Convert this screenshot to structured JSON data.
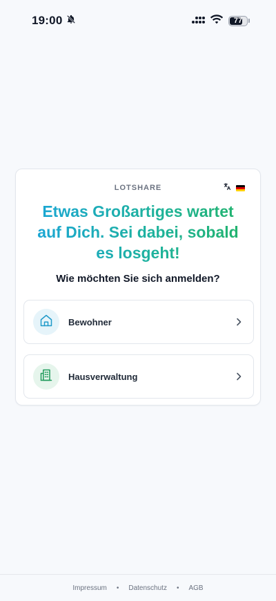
{
  "status_bar": {
    "time": "19:00",
    "battery_level": "77",
    "battery_fraction": 0.77
  },
  "card": {
    "brand": "LOTSHARE",
    "language_flag": "german-flag",
    "headline": "Etwas Großartiges wartet auf Dich. Sei dabei, sobald es losgeht!",
    "subtitle": "Wie möchten Sie sich anmelden?",
    "options": [
      {
        "label": "Bewohner",
        "icon": "home-icon",
        "icon_bg": "#e6f4fa",
        "icon_color": "#1f9ac9"
      },
      {
        "label": "Hausverwaltung",
        "icon": "building-icon",
        "icon_bg": "#e6f5ec",
        "icon_color": "#1e9a5b"
      }
    ]
  },
  "footer": {
    "links": [
      "Impressum",
      "Datenschutz",
      "AGB"
    ],
    "separator": "•"
  },
  "colors": {
    "background": "#f7f9fc",
    "gradient_start": "#1aa5d8",
    "gradient_end": "#22b36a"
  }
}
